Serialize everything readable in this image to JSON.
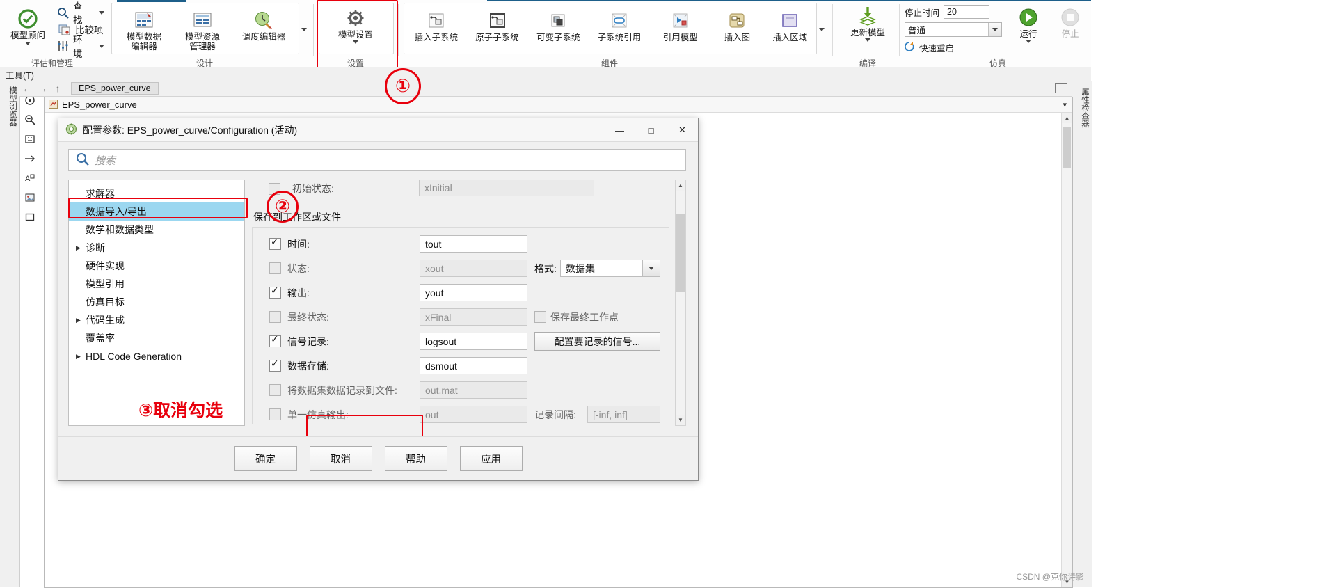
{
  "ribbon": {
    "groups": [
      {
        "label": "评估和管理"
      },
      {
        "label": "设计"
      },
      {
        "label": "设置"
      },
      {
        "label": "组件"
      },
      {
        "label": "编译"
      },
      {
        "label": "仿真"
      }
    ],
    "model_advisor": {
      "label": "模型顾问",
      "icon": "check-circle-icon"
    },
    "small_items": [
      {
        "label": "查找",
        "icon": "search-icon",
        "has_caret": true
      },
      {
        "label": "比较项",
        "icon": "compare-icon",
        "has_caret": false
      },
      {
        "label": "环境",
        "icon": "environment-icon",
        "has_caret": true
      }
    ],
    "design_buttons": [
      {
        "label_line1": "模型数据",
        "label_line2": "编辑器",
        "icon": "model-data-editor-icon"
      },
      {
        "label_line1": "模型资源",
        "label_line2": "管理器",
        "icon": "model-resource-manager-icon"
      },
      {
        "label_line1": "调度编辑器",
        "label_line2": "",
        "icon": "schedule-editor-icon"
      }
    ],
    "settings_button": {
      "label": "模型设置",
      "icon": "gear-icon",
      "has_caret": true
    },
    "component_buttons": [
      {
        "label": "插入子系统",
        "icon": "insert-subsystem-icon"
      },
      {
        "label": "原子子系统",
        "icon": "atomic-subsystem-icon"
      },
      {
        "label": "可变子系统",
        "icon": "variant-subsystem-icon"
      },
      {
        "label": "子系统引用",
        "icon": "subsystem-reference-icon"
      },
      {
        "label": "引用模型",
        "icon": "model-reference-icon"
      },
      {
        "label": "插入图",
        "icon": "insert-chart-icon"
      },
      {
        "label": "插入区域",
        "icon": "insert-area-icon"
      }
    ],
    "compile_button": {
      "label": "更新模型",
      "icon": "update-model-icon",
      "has_caret": true
    },
    "simulation": {
      "stop_time_label": "停止时间",
      "stop_time_value": "20",
      "mode_value": "普通",
      "fast_restart_label": "快速重启",
      "run_label": "运行",
      "stop_label": "停止"
    }
  },
  "menu_strip": {
    "label": "工具(T)"
  },
  "rails": {
    "left_label": "模型浏览器",
    "right_label": "属性检查器",
    "tool_buttons": [
      "pointer-icon",
      "zoom-icon",
      "fit-icon",
      "arrow-icon",
      "annotation-icon",
      "image-icon",
      "box-icon"
    ]
  },
  "breadcrumb": {
    "model_name": "EPS_power_curve"
  },
  "canvas": {
    "title": "EPS_power_curve"
  },
  "dialog": {
    "title": "配置参数: EPS_power_curve/Configuration (活动)",
    "icon": "config-params-icon",
    "minimize": "—",
    "maximize": "□",
    "close": "✕",
    "search_placeholder": "搜索",
    "search_icon": "search-icon",
    "tree": [
      {
        "label": "求解器",
        "expandable": false,
        "selected": false
      },
      {
        "label": "数据导入/导出",
        "expandable": false,
        "selected": true
      },
      {
        "label": "数学和数据类型",
        "expandable": false,
        "selected": false
      },
      {
        "label": "诊断",
        "expandable": true,
        "selected": false
      },
      {
        "label": "硬件实现",
        "expandable": false,
        "selected": false
      },
      {
        "label": "模型引用",
        "expandable": false,
        "selected": false
      },
      {
        "label": "仿真目标",
        "expandable": false,
        "selected": false
      },
      {
        "label": "代码生成",
        "expandable": true,
        "selected": false
      },
      {
        "label": "覆盖率",
        "expandable": false,
        "selected": false
      },
      {
        "label": "HDL Code Generation",
        "expandable": true,
        "selected": false
      }
    ],
    "top_partial_field": {
      "label": "初始状态:",
      "value": "xInitial",
      "checked": false,
      "enabled": false
    },
    "section_title": "保存到工作区或文件",
    "format_label": "格式:",
    "format_value": "数据集",
    "save_final_op_label": "保存最终工作点",
    "save_final_op_checked": false,
    "configure_signals_button": "配置要记录的信号...",
    "log_interval_label": "记录间隔:",
    "log_interval_value": "[-inf, inf]",
    "rows": [
      {
        "label": "时间:",
        "value": "tout",
        "checked": true,
        "enabled": true
      },
      {
        "label": "状态:",
        "value": "xout",
        "checked": false,
        "enabled": false
      },
      {
        "label": "输出:",
        "value": "yout",
        "checked": true,
        "enabled": true
      },
      {
        "label": "最终状态:",
        "value": "xFinal",
        "checked": false,
        "enabled": false
      },
      {
        "label": "信号记录:",
        "value": "logsout",
        "checked": true,
        "enabled": true
      },
      {
        "label": "数据存储:",
        "value": "dsmout",
        "checked": true,
        "enabled": true
      },
      {
        "label": "将数据集数据记录到文件:",
        "value": "out.mat",
        "checked": false,
        "enabled": false
      },
      {
        "label": "单一仿真输出:",
        "value": "out",
        "checked": false,
        "enabled": false
      }
    ],
    "footer_buttons": [
      "确定",
      "取消",
      "帮助",
      "应用"
    ]
  },
  "annotations": {
    "marker1": "①",
    "marker2": "②",
    "marker3_text": "③取消勾选",
    "color": "#e8000d"
  },
  "watermark": "CSDN @克你诗影"
}
